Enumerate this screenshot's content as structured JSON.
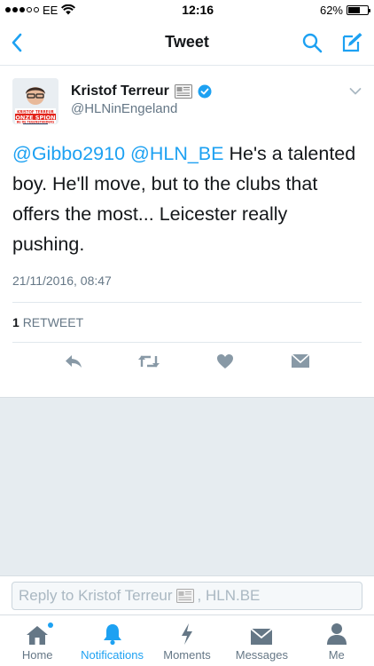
{
  "status": {
    "carrier": "EE",
    "time": "12:16",
    "battery": "62%",
    "battery_level": 0.62
  },
  "nav": {
    "title": "Tweet"
  },
  "tweet": {
    "author_name": "Kristof Terreur",
    "handle": "@HLNinEngeland",
    "avatar_caption": "ONZE SPION",
    "avatar_subcaption": "KRISTOF TERREUR",
    "avatar_footer": "BIJ DE TEGENSTANDERS",
    "mention_1": "@Gibbo2910",
    "mention_2": "@HLN_BE",
    "body": " He's a talented boy. He'll move, but to the clubs that offers the most... Leicester really pushing.",
    "timestamp": "21/11/2016, 08:47",
    "retweet_count": "1",
    "retweet_label": "RETWEET"
  },
  "reply": {
    "prefix": "Reply to Kristof Terreur",
    "suffix": ", HLN.BE"
  },
  "tabs": [
    {
      "label": "Home"
    },
    {
      "label": "Notifications"
    },
    {
      "label": "Moments"
    },
    {
      "label": "Messages"
    },
    {
      "label": "Me"
    }
  ],
  "colors": {
    "accent": "#1da1f2",
    "icon_gray": "#657786",
    "background_gray": "#e6ecf0"
  }
}
